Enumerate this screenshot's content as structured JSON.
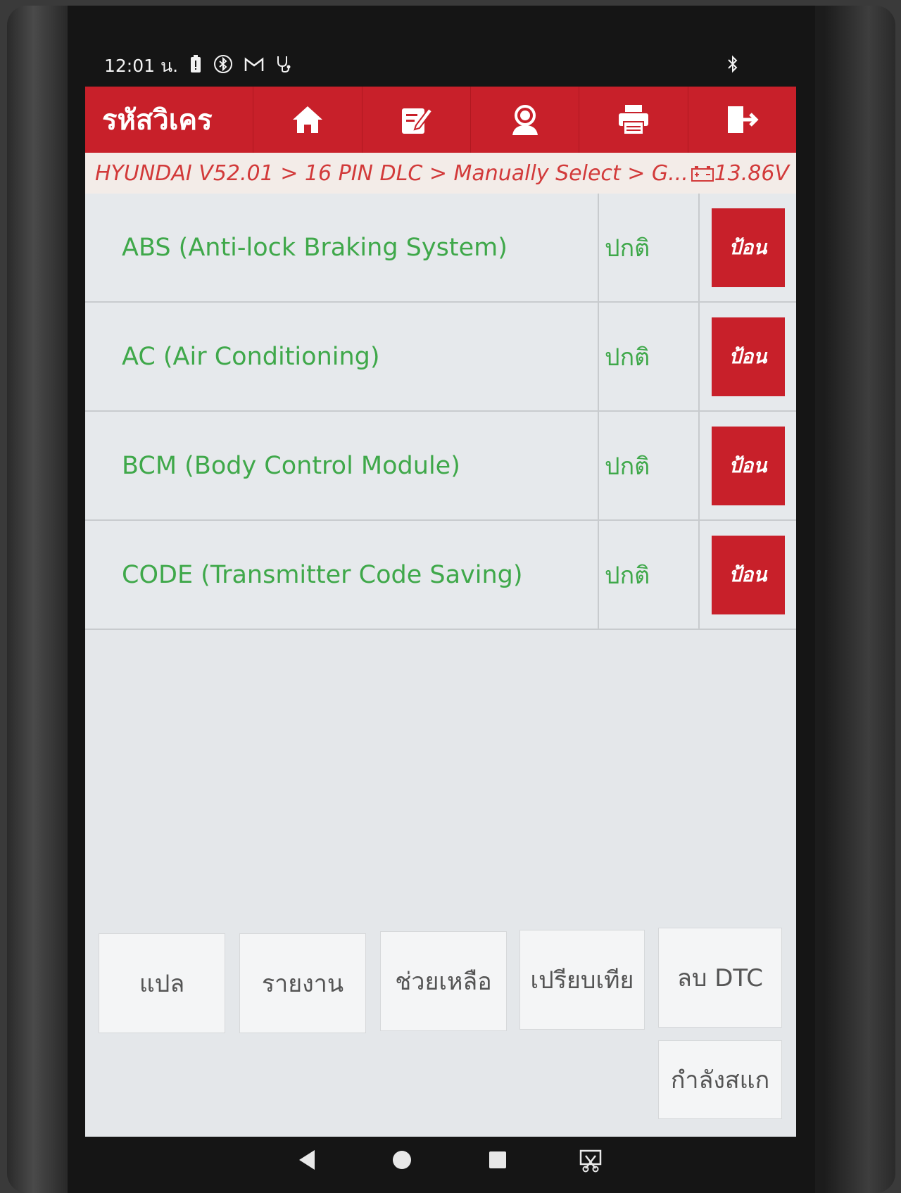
{
  "status_bar": {
    "time": "12:01 น.",
    "icons": [
      "battery-alert-icon",
      "bluetooth-circle-icon",
      "gmail-icon",
      "stethoscope-icon"
    ],
    "right_icon": "bluetooth-icon"
  },
  "toolbar": {
    "title": "รหัสวิเคร",
    "buttons": [
      "home-icon",
      "edit-icon",
      "support-icon",
      "print-icon",
      "exit-icon"
    ]
  },
  "breadcrumb": {
    "path": "HYUNDAI V52.01 > 16 PIN DLC > Manually Select > G...",
    "voltage": "13.86V"
  },
  "systems": [
    {
      "name": "ABS (Anti-lock Braking System)",
      "status": "ปกติ",
      "action": "ป้อน"
    },
    {
      "name": "AC (Air Conditioning)",
      "status": "ปกติ",
      "action": "ป้อน"
    },
    {
      "name": "BCM (Body Control Module)",
      "status": "ปกติ",
      "action": "ป้อน"
    },
    {
      "name": "CODE (Transmitter Code Saving)",
      "status": "ปกติ",
      "action": "ป้อน"
    }
  ],
  "actions": {
    "translate": "แปล",
    "report": "รายงาน",
    "help": "ช่วยเหลือ",
    "compare": "เปรียบเทีย",
    "clear_dtc": "ลบ DTC",
    "scanning": "กำลังสแก"
  },
  "colors": {
    "accent": "#c8202a",
    "system_text": "#3fa84a",
    "breadcrumb_text": "#d23a3a"
  },
  "nav": [
    "back-icon",
    "home-circle-icon",
    "recents-icon",
    "screenshot-icon"
  ]
}
